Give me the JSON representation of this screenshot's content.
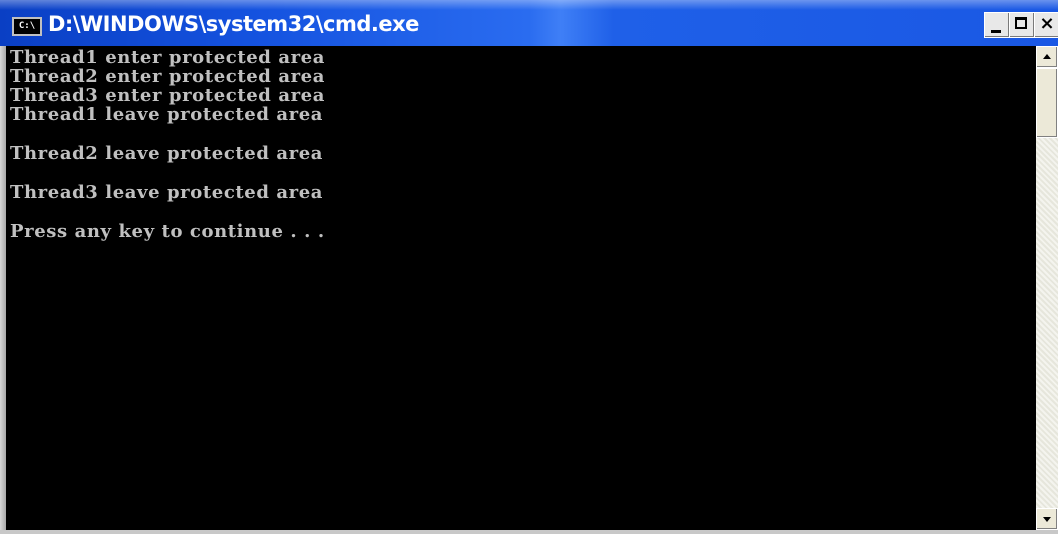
{
  "window": {
    "title": "D:\\WINDOWS\\system32\\cmd.exe",
    "icon_label": "C:\\",
    "controls": {
      "minimize_icon": "minimize-icon",
      "maximize_icon": "maximize-icon",
      "close_label": "×"
    }
  },
  "console": {
    "lines": [
      "Thread1 enter protected area",
      "Thread2 enter protected area",
      "Thread3 enter protected area",
      "Thread1 leave protected area",
      "Thread2 leave protected area",
      "Thread3 leave protected area",
      "Press any key to continue . . ."
    ],
    "colors": {
      "background": "#000000",
      "text": "#c0c0c0"
    }
  }
}
